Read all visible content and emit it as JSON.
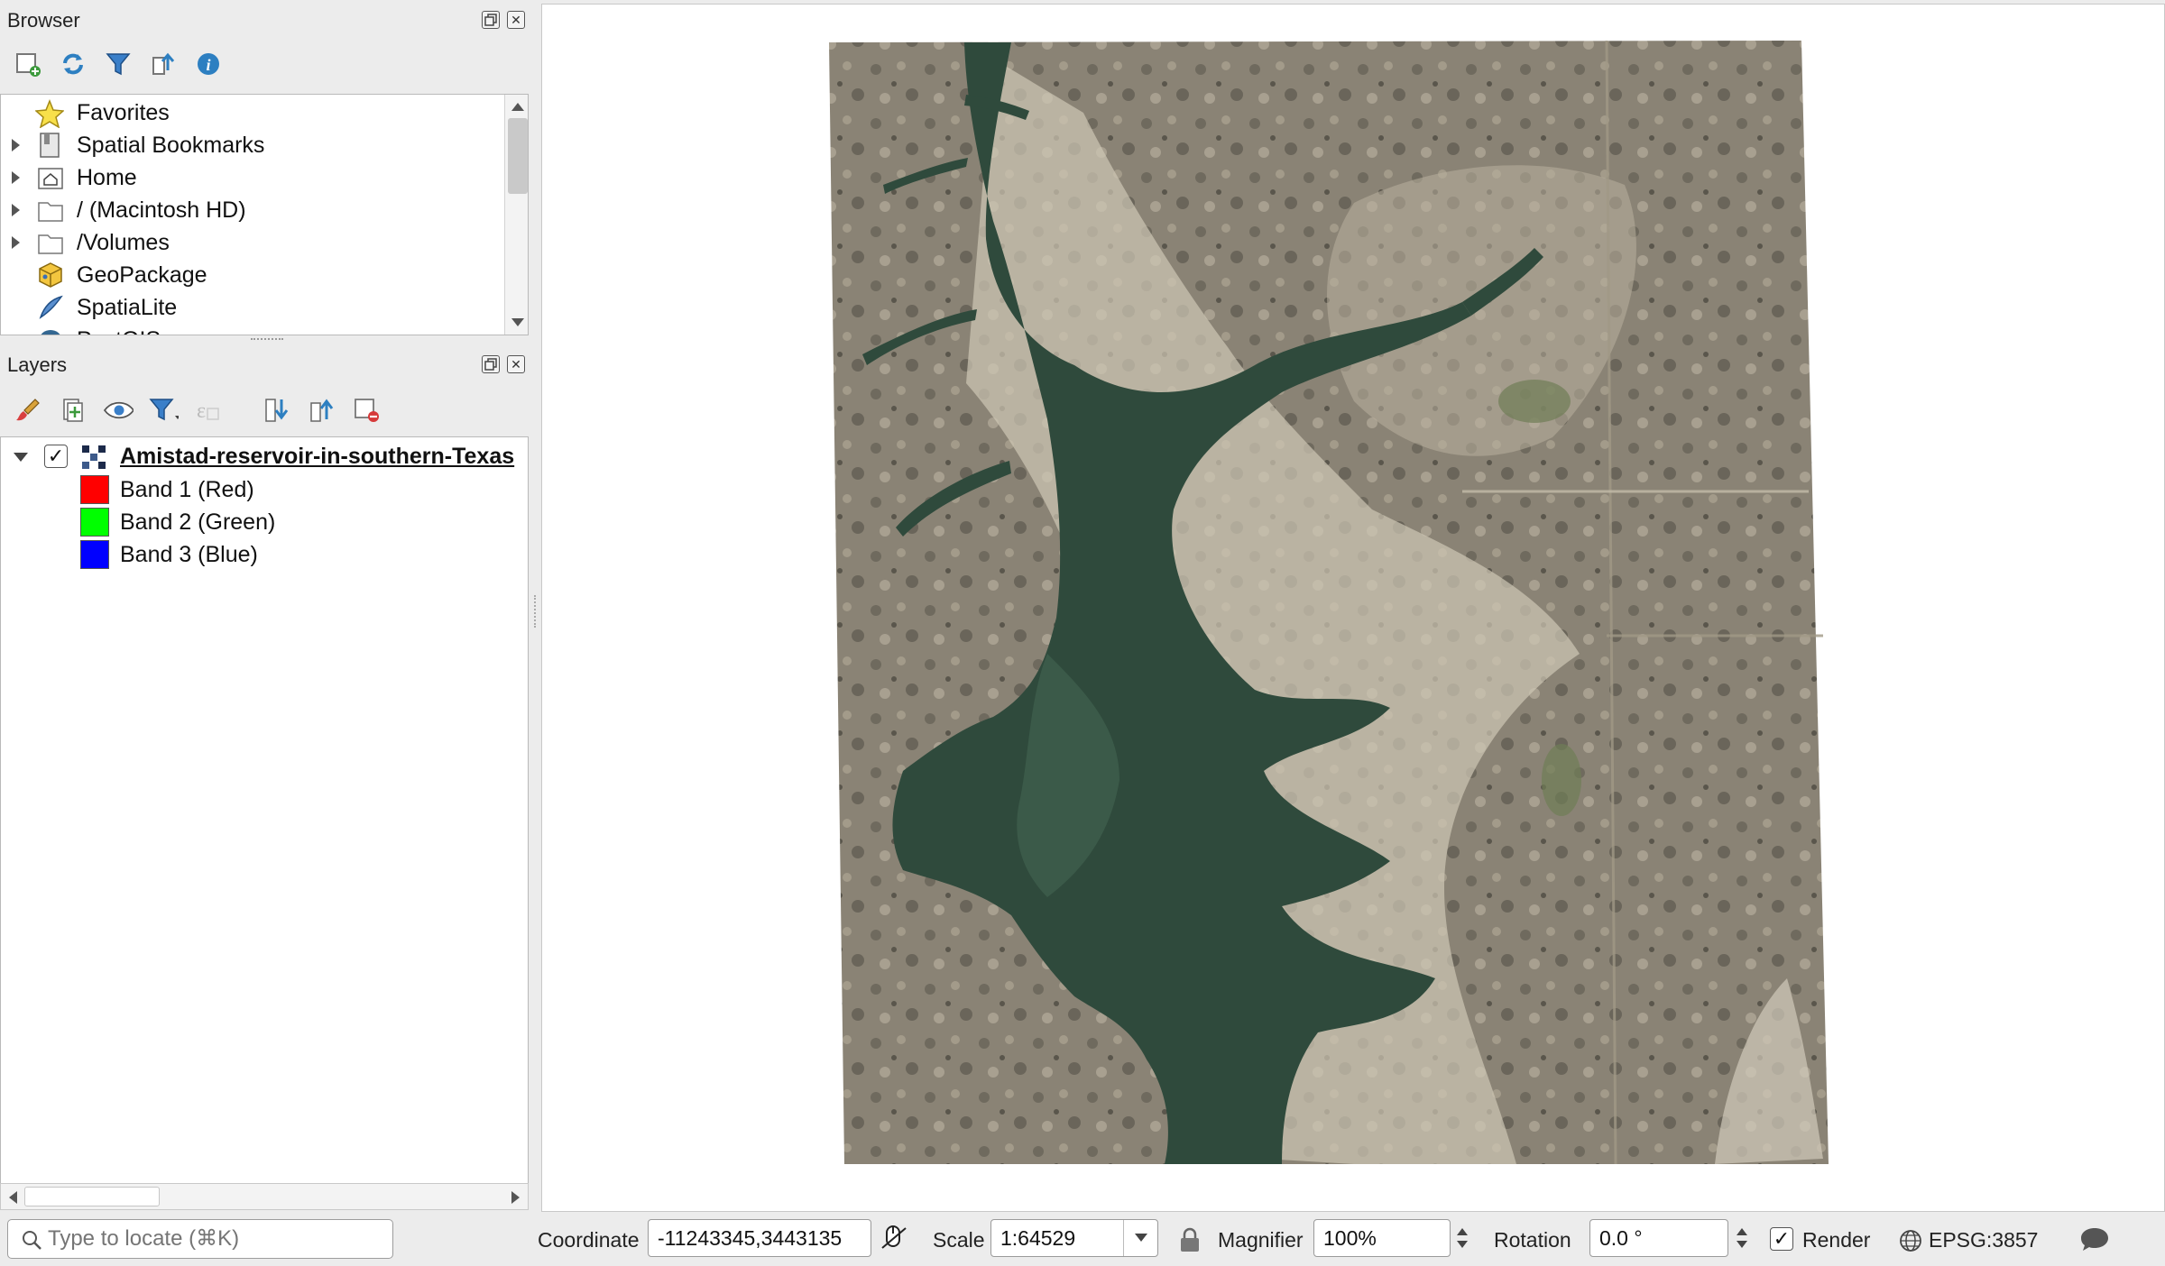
{
  "browser_panel": {
    "title": "Browser",
    "items": [
      {
        "label": "Favorites",
        "icon": "star-icon",
        "expandable": false
      },
      {
        "label": "Spatial Bookmarks",
        "icon": "bookmarks-icon",
        "expandable": true
      },
      {
        "label": "Home",
        "icon": "home-icon",
        "expandable": true
      },
      {
        "label": "/ (Macintosh HD)",
        "icon": "folder-icon",
        "expandable": true
      },
      {
        "label": "/Volumes",
        "icon": "folder-icon",
        "expandable": true
      },
      {
        "label": "GeoPackage",
        "icon": "geopackage-icon",
        "expandable": false
      },
      {
        "label": "SpatiaLite",
        "icon": "spatialite-icon",
        "expandable": false
      },
      {
        "label": "PostGIS",
        "icon": "postgis-icon",
        "expandable": false
      }
    ]
  },
  "layers_panel": {
    "title": "Layers",
    "layer": {
      "name": "Amistad-reservoir-in-southern-Texas",
      "checked": true,
      "bands": [
        {
          "label": "Band 1 (Red)",
          "color": "#ff0000"
        },
        {
          "label": "Band 2 (Green)",
          "color": "#00ff00"
        },
        {
          "label": "Band 3 (Blue)",
          "color": "#0000ff"
        }
      ]
    }
  },
  "statusbar": {
    "locate_placeholder": "Type to locate (⌘K)",
    "coordinate_label": "Coordinate",
    "coordinate_value": "-11243345,3443135",
    "scale_label": "Scale",
    "scale_value": "1:64529",
    "magnifier_label": "Magnifier",
    "magnifier_value": "100%",
    "rotation_label": "Rotation",
    "rotation_value": "0.0 °",
    "render_label": "Render",
    "render_checked": true,
    "crs_label": "EPSG:3857"
  },
  "colors": {
    "water": "#2f4a3c",
    "land": "#8a8375",
    "shore": "#d6cfbf"
  }
}
